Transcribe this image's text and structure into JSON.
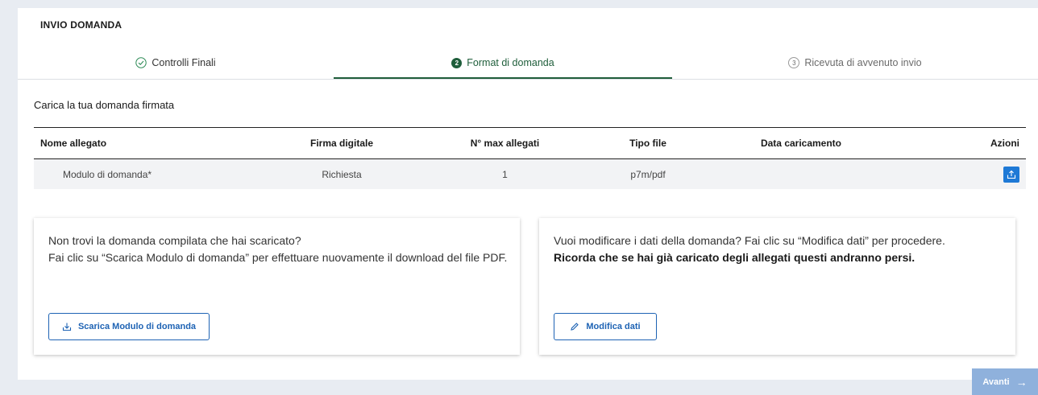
{
  "section": {
    "title": "INVIO DOMANDA"
  },
  "stepper": {
    "steps": [
      {
        "label": "Controlli Finali",
        "state": "completed"
      },
      {
        "number": "2",
        "label": "Format di domanda",
        "state": "active"
      },
      {
        "number": "3",
        "label": "Ricevuta di avvenuto invio",
        "state": "pending"
      }
    ]
  },
  "upload": {
    "title": "Carica la tua domanda firmata",
    "columns": [
      "Nome allegato",
      "Firma digitale",
      "N° max allegati",
      "Tipo file",
      "Data caricamento",
      "Azioni"
    ],
    "rows": [
      {
        "name": "Modulo di domanda*",
        "signature": "Richiesta",
        "max": "1",
        "type": "p7m/pdf",
        "date": "",
        "action_icon": "upload-icon"
      }
    ]
  },
  "card_download": {
    "line1": "Non trovi la domanda compilata che hai scaricato?",
    "line2": "Fai clic su “Scarica Modulo di domanda” per effettuare nuovamente il download del file PDF.",
    "button": "Scarica Modulo di domanda",
    "icon": "download-icon"
  },
  "card_edit": {
    "line1": "Vuoi modificare i dati della domanda? Fai clic su “Modifica dati” per procedere.",
    "line2": "Ricorda che se hai già caricato degli allegati questi andranno persi.",
    "button": "Modifica dati",
    "icon": "pencil-icon"
  },
  "footer": {
    "next_label": "Avanti",
    "next_arrow": "→"
  },
  "colors": {
    "primary": "#1e63b4",
    "success": "#1f5e3b",
    "upload": "#1e79d6",
    "disabled": "#8fb1dc"
  }
}
